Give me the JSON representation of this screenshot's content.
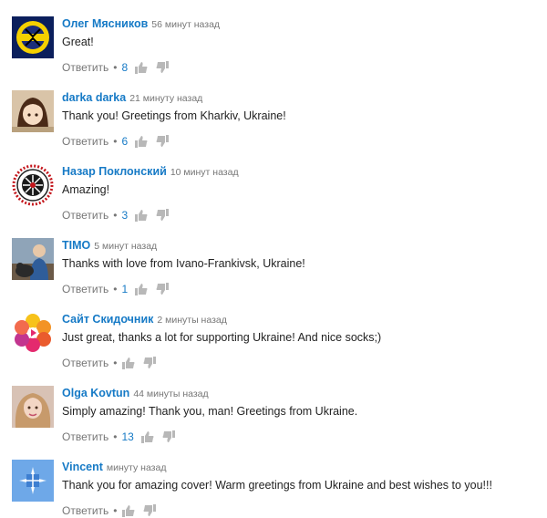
{
  "reply_label": "Ответить",
  "separator": "•",
  "comments": [
    {
      "author": "Олег Мясников",
      "time": "56 минут назад",
      "text": "Great!",
      "likes": "8"
    },
    {
      "author": "darka darka",
      "time": "21 минуту назад",
      "text": "Thank you! Greetings from Kharkiv, Ukraine!",
      "likes": "6"
    },
    {
      "author": "Назар Поклонский",
      "time": "10 минут назад",
      "text": "Amazing!",
      "likes": "3"
    },
    {
      "author": "TIMO",
      "time": "5 минут назад",
      "text": "Thanks with love from Ivano-Frankivsk, Ukraine!",
      "likes": "1"
    },
    {
      "author": "Сайт Скидочник",
      "time": "2 минуты назад",
      "text": "Just great, thanks a lot for supporting Ukraine! And nice socks;)",
      "likes": ""
    },
    {
      "author": "Olga Kovtun",
      "time": "44 минуты назад",
      "text": "Simply amazing! Thank you, man! Greetings from Ukraine.",
      "likes": "13"
    },
    {
      "author": "Vincent",
      "time": "минуту назад",
      "text": "Thank you for amazing cover! Warm greetings from Ukraine and best wishes to you!!!",
      "likes": ""
    }
  ],
  "icons": {
    "like": "thumbs-up-icon",
    "dislike": "thumbs-down-icon"
  },
  "colors": {
    "author": "#167ac6",
    "meta": "#767676",
    "text": "#222222",
    "icon": "#b8b8b8"
  }
}
